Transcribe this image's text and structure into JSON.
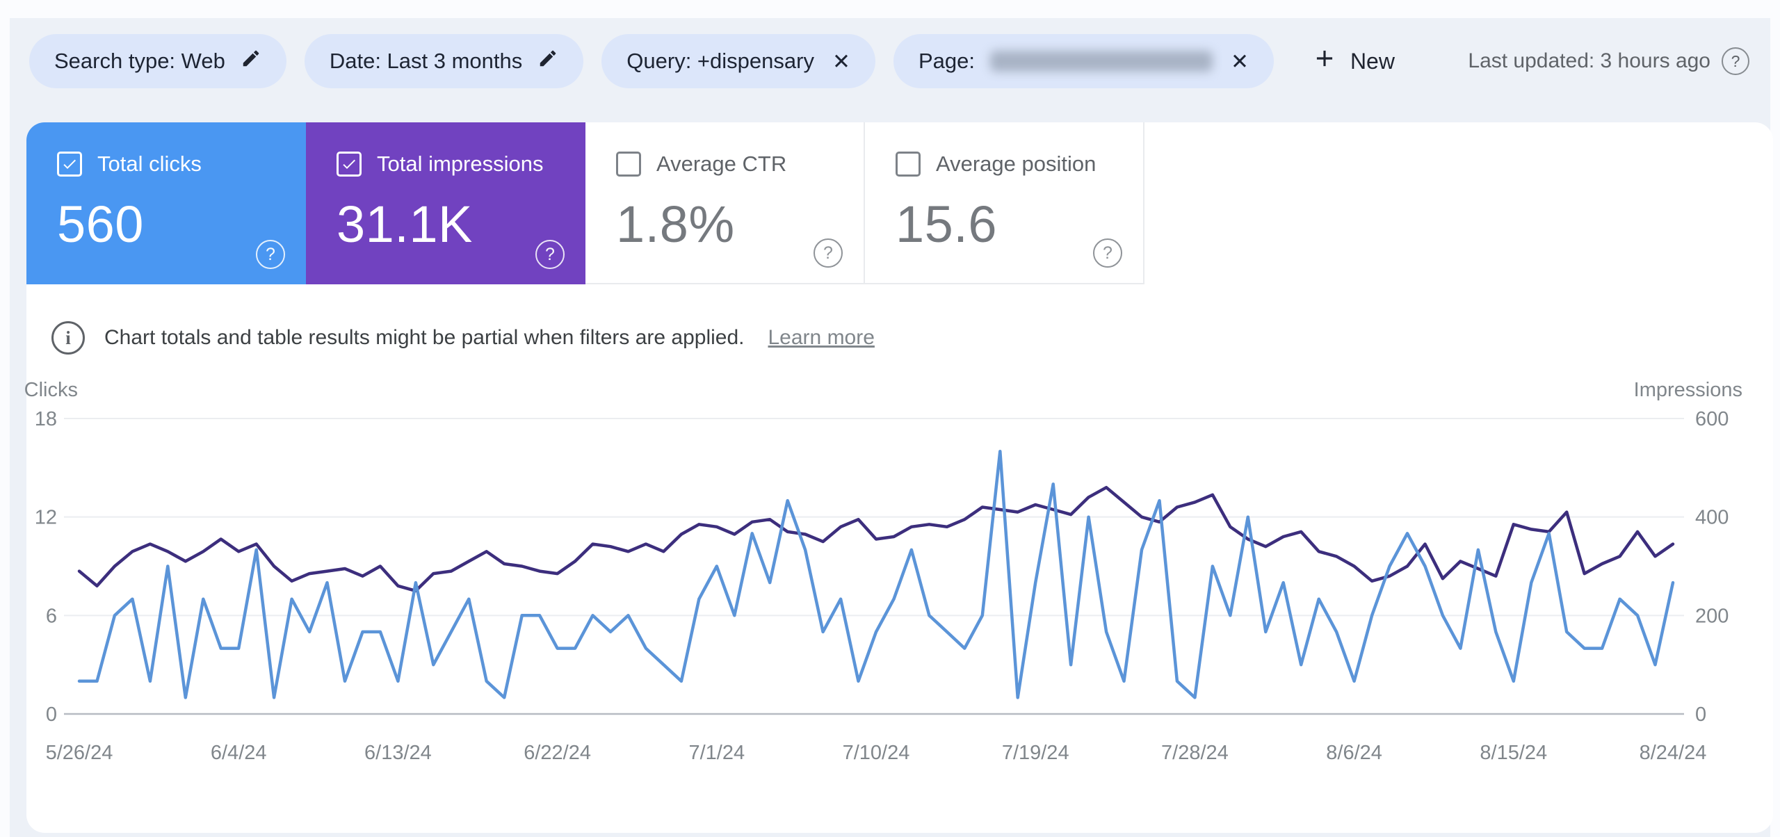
{
  "filter_bar": {
    "chips": [
      {
        "label": "Search type: Web",
        "icon": "edit"
      },
      {
        "label": "Date: Last 3 months",
        "icon": "edit"
      },
      {
        "label": "Query: +dispensary",
        "icon": "close"
      },
      {
        "label": "Page:",
        "icon": "close",
        "value_redacted": true
      }
    ],
    "new_button_label": "New",
    "last_updated": "Last updated: 3 hours ago"
  },
  "metric_cards": [
    {
      "label": "Total clicks",
      "value": "560",
      "selected": true,
      "color": "#4a97f2"
    },
    {
      "label": "Total impressions",
      "value": "31.1K",
      "selected": true,
      "color": "#7142c0"
    },
    {
      "label": "Average CTR",
      "value": "1.8%",
      "selected": false,
      "color": "#ffffff"
    },
    {
      "label": "Average position",
      "value": "15.6",
      "selected": false,
      "color": "#ffffff"
    }
  ],
  "info_banner": {
    "text": "Chart totals and table results might be partial when filters are applied.",
    "link_label": "Learn more"
  },
  "chart_data": {
    "type": "line",
    "title": "Search performance over time",
    "grid": true,
    "left_axis": {
      "label": "Clicks",
      "ticks": [
        0,
        6,
        12,
        18
      ],
      "range": [
        0,
        18
      ]
    },
    "right_axis": {
      "label": "Impressions",
      "ticks": [
        0,
        200,
        400,
        600
      ],
      "range": [
        0,
        600
      ]
    },
    "x_start": "5/26/24",
    "x_end": "8/24/24",
    "x_tick_labels": [
      "5/26/24",
      "6/4/24",
      "6/13/24",
      "6/22/24",
      "7/1/24",
      "7/10/24",
      "7/19/24",
      "7/28/24",
      "8/6/24",
      "8/15/24",
      "8/24/24"
    ],
    "series": [
      {
        "name": "Clicks",
        "axis": "left",
        "color": "#5b94d8",
        "values": [
          2,
          2,
          6,
          7,
          2,
          9,
          1,
          7,
          4,
          4,
          10,
          1,
          7,
          5,
          8,
          2,
          5,
          5,
          2,
          8,
          3,
          5,
          7,
          2,
          1,
          6,
          6,
          4,
          4,
          6,
          5,
          6,
          4,
          3,
          2,
          7,
          9,
          6,
          11,
          8,
          13,
          10,
          5,
          7,
          2,
          5,
          7,
          10,
          6,
          5,
          4,
          6,
          16,
          1,
          8,
          14,
          3,
          12,
          5,
          2,
          10,
          13,
          2,
          1,
          9,
          6,
          12,
          5,
          8,
          3,
          7,
          5,
          2,
          6,
          9,
          11,
          9,
          6,
          4,
          10,
          5,
          2,
          8,
          11,
          5,
          4,
          4,
          7,
          6,
          3,
          8
        ]
      },
      {
        "name": "Impressions",
        "axis": "right",
        "color": "#3c2e7d",
        "values": [
          290,
          260,
          300,
          330,
          345,
          330,
          310,
          330,
          355,
          330,
          345,
          300,
          270,
          285,
          290,
          295,
          280,
          300,
          260,
          250,
          285,
          290,
          310,
          330,
          305,
          300,
          290,
          285,
          310,
          345,
          340,
          330,
          345,
          330,
          365,
          385,
          380,
          365,
          390,
          395,
          370,
          365,
          350,
          380,
          395,
          355,
          360,
          380,
          385,
          380,
          395,
          420,
          415,
          410,
          425,
          415,
          405,
          440,
          460,
          430,
          400,
          390,
          420,
          430,
          445,
          380,
          355,
          340,
          360,
          370,
          330,
          320,
          300,
          270,
          280,
          300,
          345,
          275,
          310,
          295,
          280,
          385,
          375,
          370,
          410,
          285,
          305,
          320,
          370,
          320,
          345
        ]
      }
    ]
  }
}
